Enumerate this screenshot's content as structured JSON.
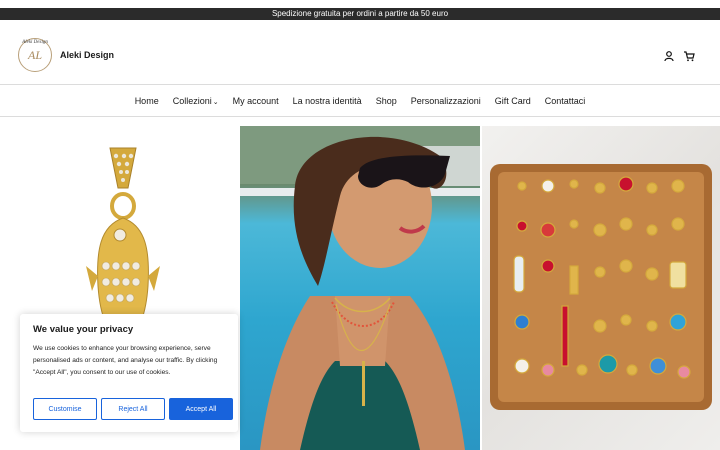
{
  "announcement": "Spedizione gratuita per ordini a partire da 50 euro",
  "brand": {
    "name": "Aleki Design",
    "logo_text": "Aleki Design",
    "logo_monogram": "AL"
  },
  "header_icons": [
    "account-icon",
    "cart-icon"
  ],
  "nav": [
    {
      "label": "Home"
    },
    {
      "label": "Collezioni",
      "has_dropdown": true
    },
    {
      "label": "My account"
    },
    {
      "label": "La nostra identità"
    },
    {
      "label": "Shop"
    },
    {
      "label": "Personalizzazioni"
    },
    {
      "label": "Gift Card"
    },
    {
      "label": "Contattaci"
    }
  ],
  "cookie": {
    "title": "We value your privacy",
    "body": "We use cookies to enhance your browsing experience, serve personalised ads or content, and analyse our traffic. By clicking \"Accept All\", you consent to our use of cookies.",
    "customise": "Customise",
    "reject": "Reject All",
    "accept": "Accept All"
  },
  "colors": {
    "accent": "#1863dc",
    "announcement_bg": "#2b2b2b",
    "gold": "#d4a93c"
  }
}
